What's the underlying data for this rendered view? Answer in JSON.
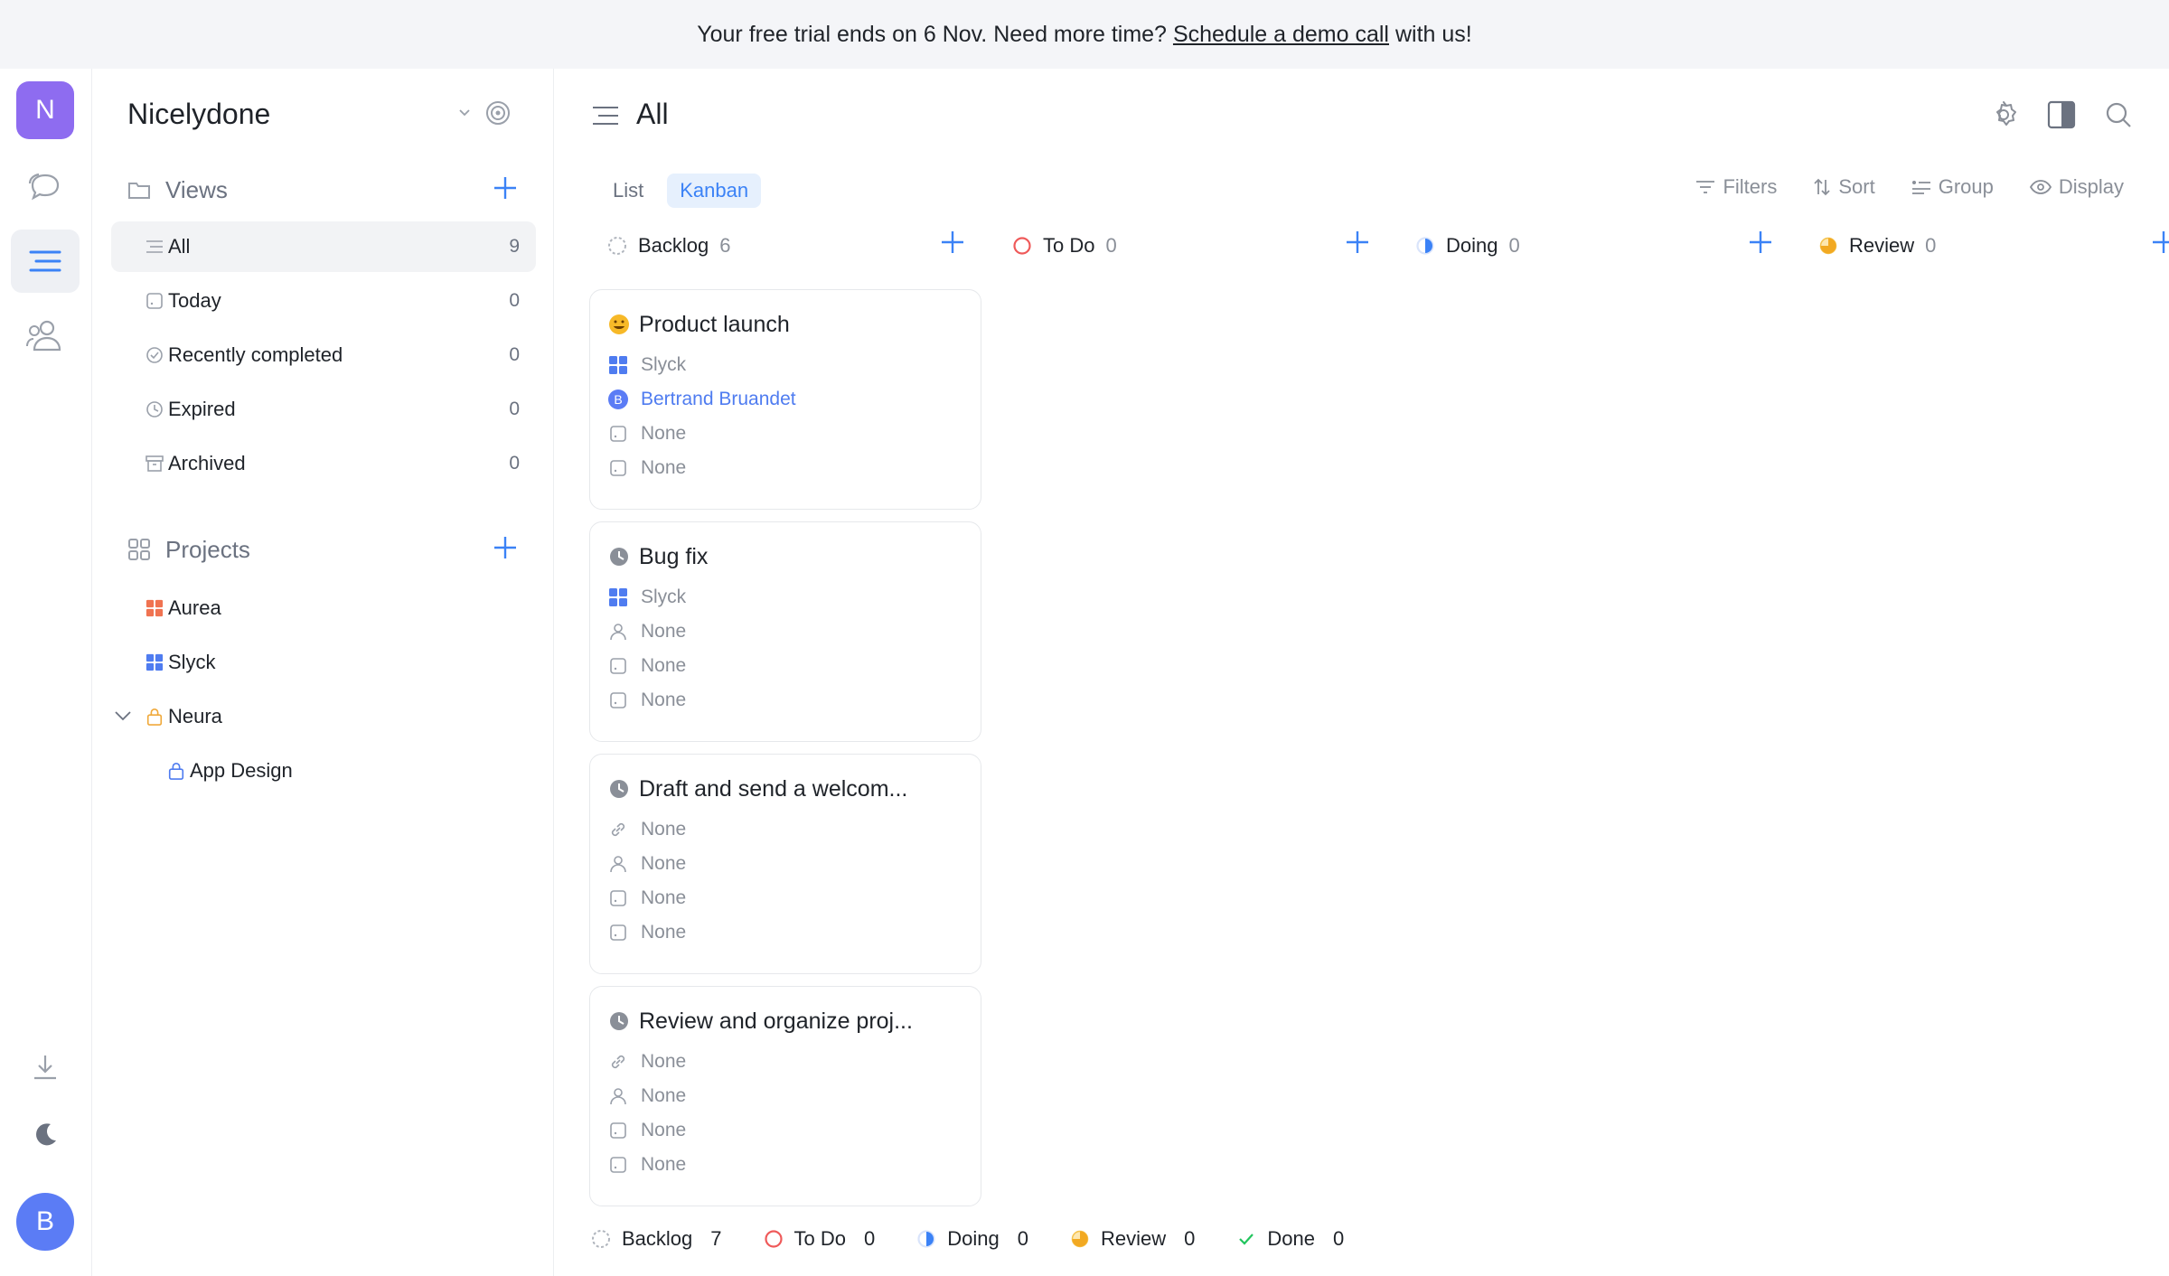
{
  "banner": {
    "text_before": "Your free trial ends on 6 Nov. Need more time?",
    "link": "Schedule a demo call",
    "text_after": "with us!"
  },
  "rail": {
    "workspace_initial": "N",
    "user_initial": "B",
    "accent": "#8e6cf0",
    "user_color": "#5b7cf5"
  },
  "sidebar": {
    "workspace_name": "Nicelydone",
    "views_label": "Views",
    "views": [
      {
        "label": "All",
        "count": "9",
        "icon": "list-icon"
      },
      {
        "label": "Today",
        "count": "0",
        "icon": "calendar-icon"
      },
      {
        "label": "Recently completed",
        "count": "0",
        "icon": "check-circle-icon"
      },
      {
        "label": "Expired",
        "count": "0",
        "icon": "clock-icon"
      },
      {
        "label": "Archived",
        "count": "0",
        "icon": "archive-icon"
      }
    ],
    "projects_label": "Projects",
    "projects": [
      {
        "label": "Aurea",
        "icon": "grid-icon",
        "color": "#f07351"
      },
      {
        "label": "Slyck",
        "icon": "grid-icon",
        "color": "#4f7cf0"
      },
      {
        "label": "Neura",
        "icon": "lock-icon",
        "color": "#f0a93b"
      },
      {
        "label": "App Design",
        "icon": "lock-icon",
        "color": "#4f7cf0"
      }
    ]
  },
  "main": {
    "title": "All",
    "tabs": [
      {
        "label": "List"
      },
      {
        "label": "Kanban"
      }
    ],
    "toolbar": {
      "filters": "Filters",
      "sort": "Sort",
      "group": "Group",
      "display": "Display"
    },
    "columns": [
      {
        "name": "Backlog",
        "count": "6"
      },
      {
        "name": "To Do",
        "count": "0"
      },
      {
        "name": "Doing",
        "count": "0"
      },
      {
        "name": "Review",
        "count": "0"
      }
    ],
    "cards": [
      {
        "title": "Product launch",
        "props": [
          "Slyck",
          "Bertrand Bruandet",
          "None",
          "None"
        ]
      },
      {
        "title": "Bug fix",
        "props": [
          "Slyck",
          "None",
          "None",
          "None"
        ]
      },
      {
        "title": "Draft and send a welcom...",
        "props": [
          "None",
          "None",
          "None",
          "None"
        ]
      },
      {
        "title": "Review and organize proj...",
        "props": [
          "None",
          "None",
          "None",
          "None"
        ]
      }
    ],
    "status_bar": [
      {
        "name": "Backlog",
        "count": "7"
      },
      {
        "name": "To Do",
        "count": "0"
      },
      {
        "name": "Doing",
        "count": "0"
      },
      {
        "name": "Review",
        "count": "0"
      },
      {
        "name": "Done",
        "count": "0"
      }
    ]
  }
}
